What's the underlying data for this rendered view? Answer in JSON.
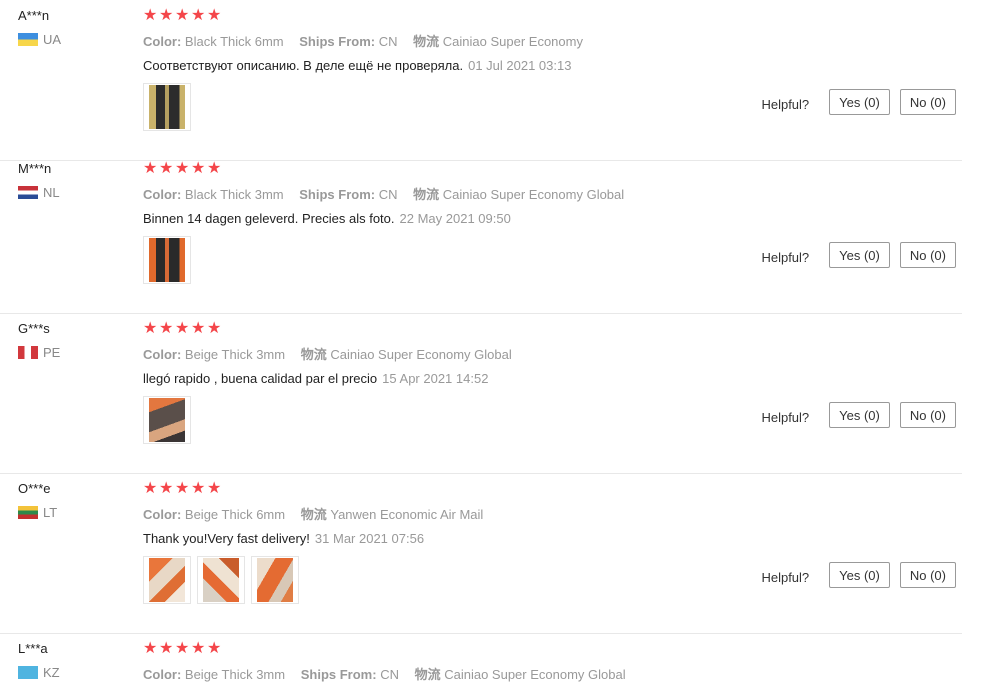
{
  "labels": {
    "color": "Color:",
    "ships_from": "Ships From:",
    "logistics": "物流",
    "helpful": "Helpful?",
    "yes": "Yes (0)",
    "no": "No (0)"
  },
  "star_color": "#f4464a",
  "reviews": [
    {
      "user": "A***n",
      "country": "UA",
      "rating": 5,
      "color": "Black Thick 6mm",
      "ships_from": "CN",
      "logistics": "Cainiao Super Economy",
      "text": "Соответствуют описанию. В деле ещё не проверяла.",
      "date": "01 Jul 2021 03:13",
      "photos": 1
    },
    {
      "user": "M***n",
      "country": "NL",
      "rating": 5,
      "color": "Black Thick 3mm",
      "ships_from": "CN",
      "logistics": "Cainiao Super Economy Global",
      "text": "Binnen 14 dagen geleverd. Precies als foto.",
      "date": "22 May 2021 09:50",
      "photos": 1
    },
    {
      "user": "G***s",
      "country": "PE",
      "rating": 5,
      "color": "Beige Thick 3mm",
      "ships_from": "",
      "logistics": "Cainiao Super Economy Global",
      "text": "llegó rapido , buena calidad par el precio",
      "date": "15 Apr 2021 14:52",
      "photos": 1
    },
    {
      "user": "O***e",
      "country": "LT",
      "rating": 5,
      "color": "Beige Thick 6mm",
      "ships_from": "",
      "logistics": "Yanwen Economic Air Mail",
      "text": "Thank you!Very fast delivery!",
      "date": "31 Mar 2021 07:56",
      "photos": 3
    },
    {
      "user": "L***a",
      "country": "KZ",
      "rating": 5,
      "color": "Beige Thick 3mm",
      "ships_from": "CN",
      "logistics": "Cainiao Super Economy Global",
      "text": "",
      "date": "",
      "photos": 0
    }
  ]
}
